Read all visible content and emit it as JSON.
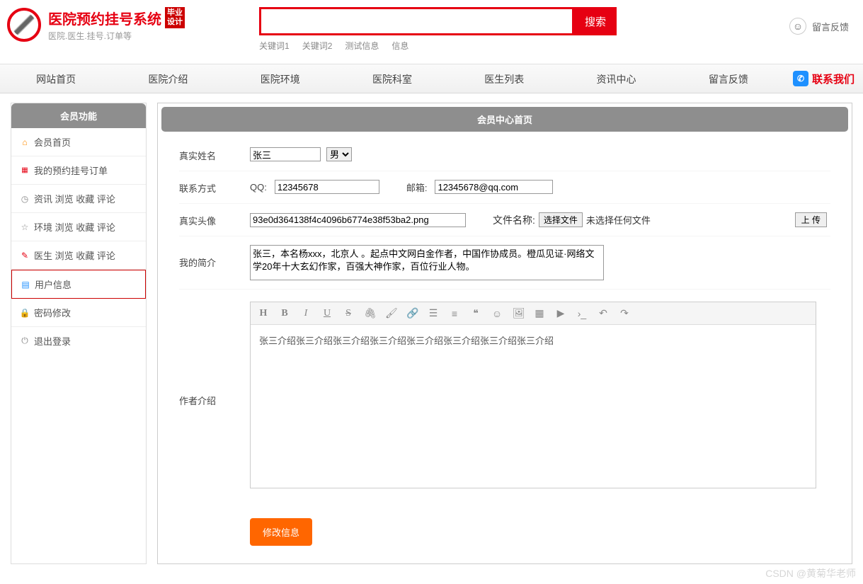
{
  "brand": {
    "title": "医院预约挂号系统",
    "tag": "毕业设计",
    "sub": "医院.医生.挂号.订单等"
  },
  "search": {
    "placeholder": "",
    "button": "搜索",
    "keywords": [
      "关键词1",
      "关键词2",
      "测试信息",
      "信息"
    ]
  },
  "feedback": "留言反馈",
  "nav": [
    "网站首页",
    "医院介绍",
    "医院环境",
    "医院科室",
    "医生列表",
    "资讯中心",
    "留言反馈"
  ],
  "contact": "联系我们",
  "sidebar": {
    "header": "会员功能",
    "items": [
      {
        "label": "会员首页"
      },
      {
        "label": "我的预约挂号订单"
      },
      {
        "label": "资讯 浏览 收藏 评论"
      },
      {
        "label": "环境 浏览 收藏 评论"
      },
      {
        "label": "医生 浏览 收藏 评论"
      },
      {
        "label": "用户信息"
      },
      {
        "label": "密码修改"
      },
      {
        "label": "退出登录"
      }
    ]
  },
  "content": {
    "header": "会员中心首页",
    "form": {
      "name_label": "真实姓名",
      "name_value": "张三",
      "gender_value": "男",
      "contact_label": "联系方式",
      "qq_label": "QQ:",
      "qq_value": "12345678",
      "email_label": "邮箱:",
      "email_value": "12345678@qq.com",
      "avatar_label": "真实头像",
      "avatar_value": "93e0d364138f4c4096b6774e38f53ba2.png",
      "file_label": "文件名称:",
      "file_button": "选择文件",
      "file_status": "未选择任何文件",
      "upload_button": "上 传",
      "bio_label": "我的简介",
      "bio_value": "张三，本名杨xxx，北京人 。起点中文网白金作者，中国作协成员。橙瓜见证·网络文学20年十大玄幻作家，百强大神作家，百位行业人物。",
      "intro_label": "作者介绍",
      "intro_value": "张三介绍张三介绍张三介绍张三介绍张三介绍张三介绍张三介绍张三介绍",
      "submit": "修改信息"
    }
  },
  "watermark": "CSDN @黄菊华老师"
}
